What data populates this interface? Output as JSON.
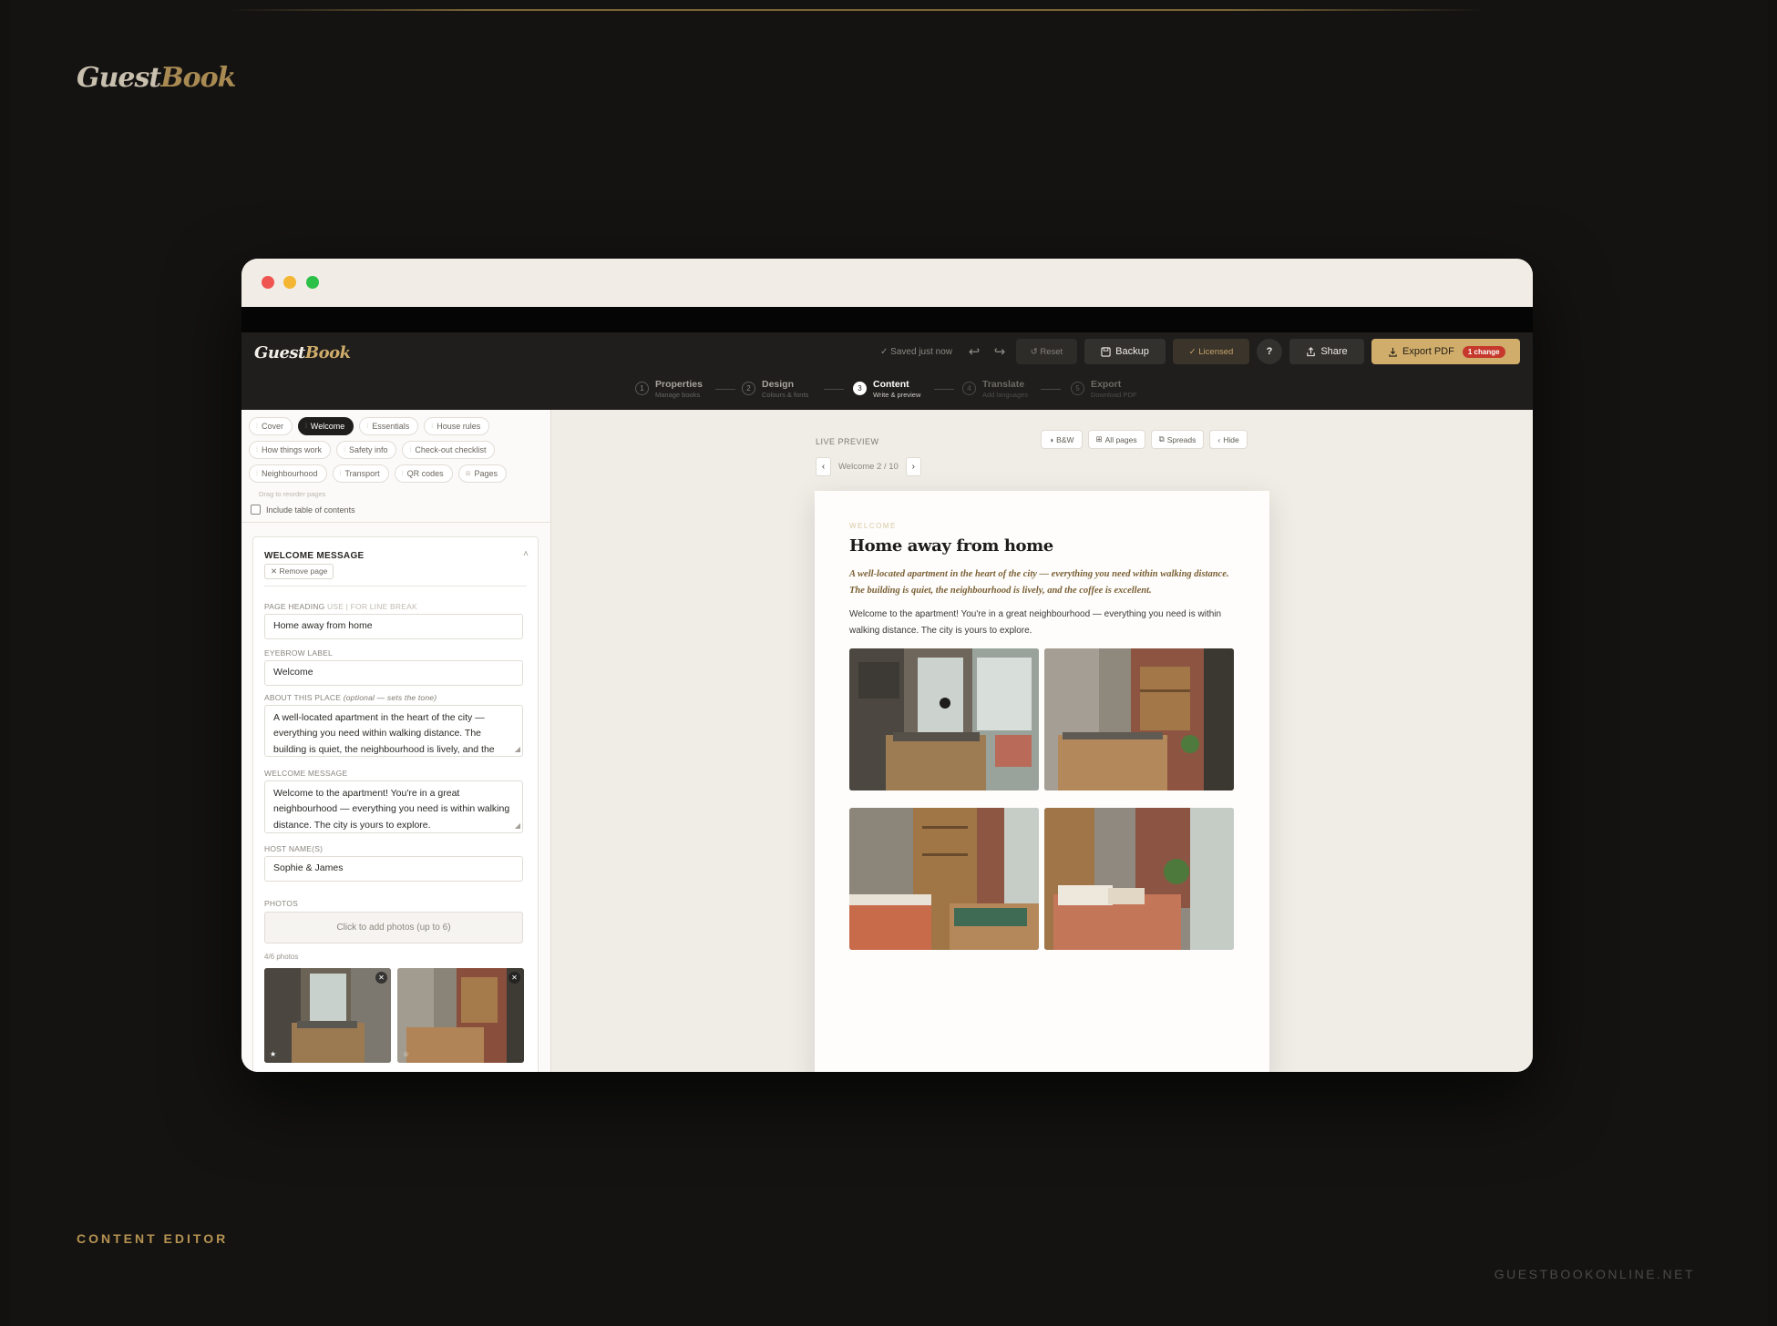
{
  "brand": {
    "part1": "Guest",
    "part2": "Book"
  },
  "caption_left": "CONTENT EDITOR",
  "caption_right": "GUESTBOOKONLINE.NET",
  "app": {
    "logo_part1": "Guest",
    "logo_part2": "Book",
    "saved_status": "✓ Saved just now",
    "reset_label": "↺ Reset",
    "backup_label": "Backup",
    "licensed_label": "✓ Licensed",
    "help_label": "?",
    "share_label": "Share",
    "export_label": "Export PDF",
    "export_badge": "1 change"
  },
  "steps": [
    {
      "num": "1",
      "title": "Properties",
      "sub": "Manage books"
    },
    {
      "num": "2",
      "title": "Design",
      "sub": "Colours & fonts"
    },
    {
      "num": "3",
      "title": "Content",
      "sub": "Write & preview"
    },
    {
      "num": "4",
      "title": "Translate",
      "sub": "Add languages"
    },
    {
      "num": "5",
      "title": "Export",
      "sub": "Download PDF"
    }
  ],
  "page_tabs": {
    "row1": [
      "Cover",
      "Welcome",
      "Essentials",
      "House rules"
    ],
    "row2": [
      "How things work",
      "Safety info",
      "Check-out checklist"
    ],
    "row3": [
      "Neighbourhood",
      "Transport",
      "QR codes",
      "Pages"
    ],
    "active": "Welcome",
    "drag_hint": "Drag to reorder pages",
    "toc_label": "Include table of contents"
  },
  "editor": {
    "section_title": "WELCOME MESSAGE",
    "remove_label": "✕ Remove page",
    "heading_label": "PAGE HEADING",
    "heading_hint": "USE | FOR LINE BREAK",
    "heading_value": "Home away from home",
    "eyebrow_label": "EYEBROW LABEL",
    "eyebrow_value": "Welcome",
    "about_label": "ABOUT THIS PLACE",
    "about_hint": "(optional — sets the tone)",
    "about_value": "A well-located apartment in the heart of the city — everything you need within walking distance. The building is quiet, the neighbourhood is lively, and the",
    "welcome_label": "WELCOME MESSAGE",
    "welcome_value": "Welcome to the apartment! You're in a great neighbourhood — everything you need is within walking distance. The city is yours to explore.",
    "host_label": "HOST NAME(S)",
    "host_value": "Sophie & James",
    "photos_label": "PHOTOS",
    "add_photos": "Click to add photos (up to 6)",
    "photo_count": "4/6 photos"
  },
  "preview": {
    "label": "LIVE PREVIEW",
    "bw": "B&W",
    "all_pages": "All pages",
    "spreads": "Spreads",
    "hide": "Hide",
    "pager_text": "Welcome 2 / 10",
    "eyebrow": "WELCOME",
    "heading": "Home away from home",
    "about": "A well-located apartment in the heart of the city — everything you need within walking distance. The building is quiet, the neighbourhood is lively, and the coffee is excellent.",
    "welcome": "Welcome to the apartment! You're in a great neighbourhood — everything you need is within walking distance. The city is yours to explore."
  },
  "colors": {
    "accent_gold": "#d0ad6b",
    "dark_bar": "#1f1e1c",
    "badge_red": "#c6382c"
  }
}
